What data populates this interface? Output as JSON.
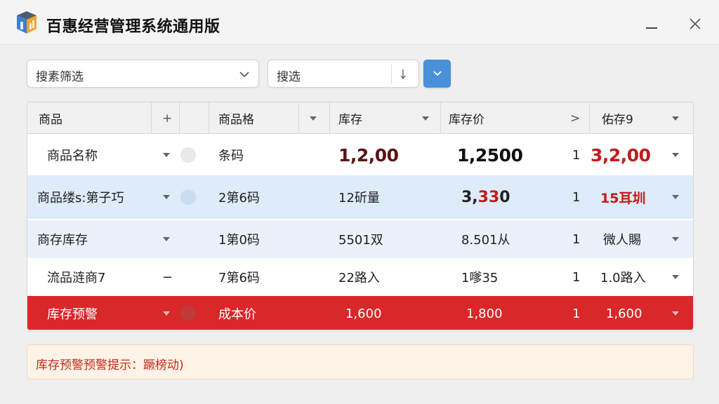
{
  "window": {
    "title": "百惠经营管理系统通用版",
    "minimize_icon": "minimize-icon",
    "close_icon": "close-icon"
  },
  "filters": {
    "search_select": "搜素筛选",
    "sort_select": "搜选",
    "accent": "#4a90d9"
  },
  "table": {
    "headers": [
      "商品",
      "+",
      "商品格",
      "库存",
      "库存价",
      ">",
      "佑存9"
    ],
    "rows": [
      {
        "name": "商品名称",
        "code": "条码",
        "stock": "1,2,00",
        "price": "1,2500",
        "count": "1",
        "extra": "3,2,00"
      },
      {
        "name": "商品缕s:第子巧",
        "code": "2第6码",
        "stock": "12斫量",
        "price_black": "3,",
        "price_red": "33",
        "price_tail": " 0",
        "count": "1",
        "extra": "15耳圳"
      },
      {
        "name": "商存库存",
        "code": "1第0码",
        "stock": "5501双",
        "price": "8.501从",
        "count": "1",
        "extra": "微人賜"
      },
      {
        "name": "流品涟商7",
        "sep": "−",
        "code": "7第6码",
        "stock": "22路入",
        "price": "1嗲35",
        "count": "1",
        "extra": "1.0路入"
      },
      {
        "name": "库存预警",
        "code": "成本价",
        "stock": "1,600",
        "price": "1,800",
        "count": "1",
        "extra": "1,600"
      }
    ],
    "colors": {
      "highlight_row": "#deebf9",
      "alert_row": "#d8282a",
      "red_text": "#c41a1a"
    }
  },
  "warning": {
    "text": "库存预警预警提示：蹶榜动)"
  }
}
